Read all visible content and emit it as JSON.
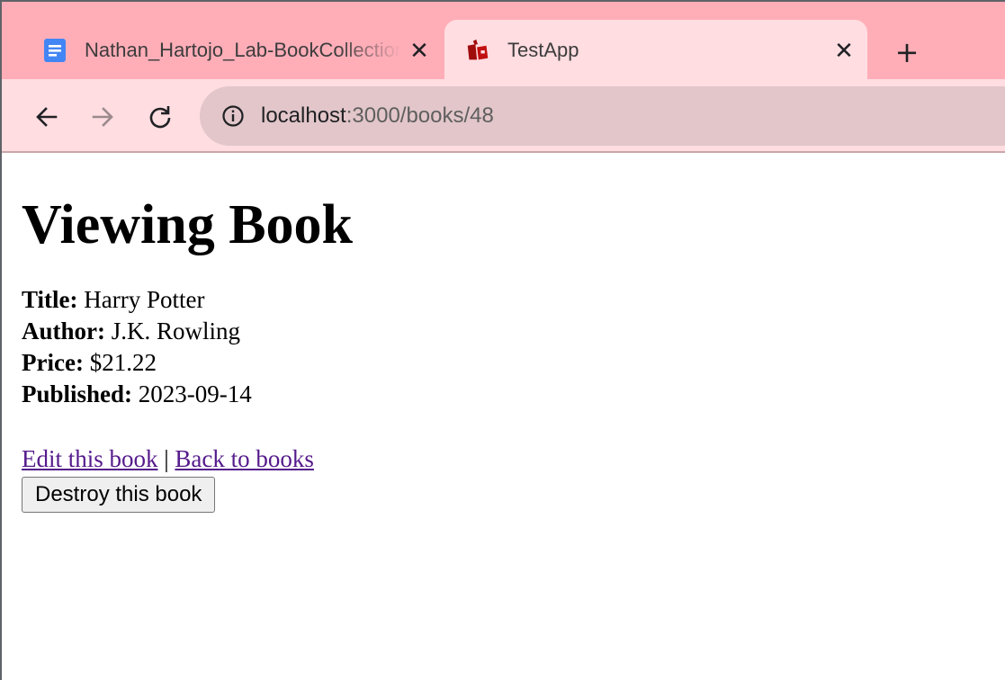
{
  "browser": {
    "tabs": [
      {
        "title": "Nathan_Hartojo_Lab-BookCollection",
        "icon": "google-docs-icon",
        "close": "✕"
      },
      {
        "title": "TestApp",
        "icon": "rails-icon",
        "close": "✕",
        "active": true
      }
    ],
    "new_tab": "+",
    "url_host": "localhost",
    "url_path": ":3000/books/48",
    "colors": {
      "tabstrip": "#ffaeb8",
      "active_tab": "#ffdde1",
      "omnibox": "#e2c6ca"
    }
  },
  "page": {
    "heading": "Viewing Book",
    "fields": [
      {
        "label": "Title:",
        "value": "Harry Potter"
      },
      {
        "label": "Author:",
        "value": "J.K. Rowling"
      },
      {
        "label": "Price:",
        "value": "$21.22"
      },
      {
        "label": "Published:",
        "value": "2023-09-14"
      }
    ],
    "edit_link": "Edit this book",
    "separator": "|",
    "back_link": "Back to books",
    "destroy_button": "Destroy this book",
    "link_color": "#551a8b"
  }
}
